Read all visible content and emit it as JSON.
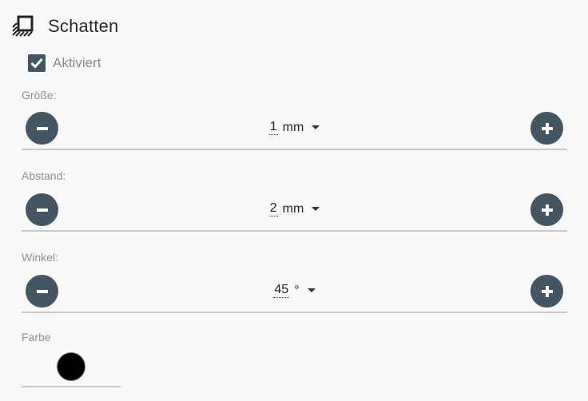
{
  "header": {
    "title": "Schatten",
    "icon": "shadow-icon"
  },
  "enabled": {
    "label": "Aktiviert",
    "checked": true
  },
  "size": {
    "label": "Größe:",
    "value": "1",
    "unit": "mm"
  },
  "distance": {
    "label": "Abstand:",
    "value": "2",
    "unit": "mm"
  },
  "angle": {
    "label": "Winkel:",
    "value": "45",
    "unit": "°"
  },
  "color": {
    "label": "Farbe",
    "value": "#000000"
  },
  "colors": {
    "button": "#445663",
    "checkbox": "#445663"
  }
}
